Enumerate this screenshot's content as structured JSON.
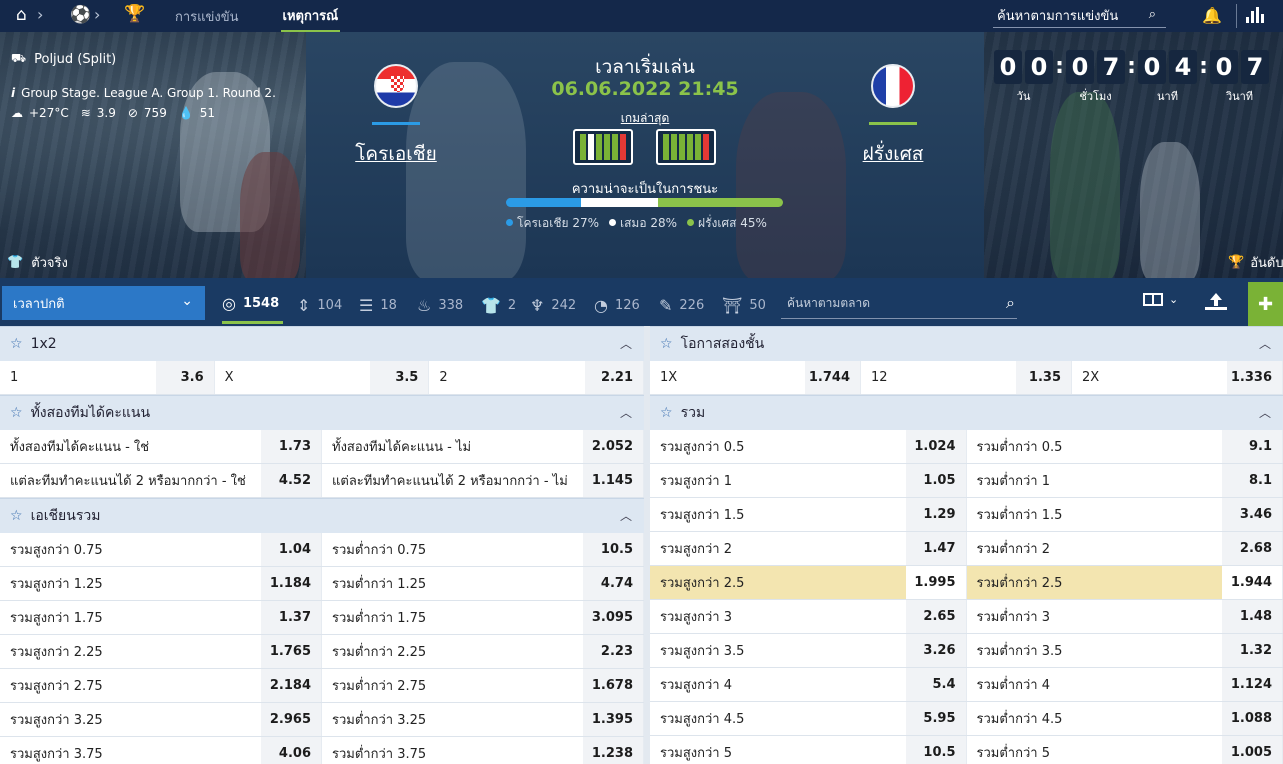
{
  "topnav": {
    "tabs": [
      {
        "label": "การแข่งขัน",
        "active": false
      },
      {
        "label": "เหตุการณ์",
        "active": true
      }
    ],
    "search_label": "ค้นหาตามการแข่งขัน"
  },
  "match": {
    "venue": "Poljud (Split)",
    "stage": "Group Stage. League A. Group 1. Round 2.",
    "weather": {
      "temp": "+27°C",
      "wind": "3.9",
      "pressure": "759",
      "humidity": "51"
    },
    "kickoff_label": "เวลาเริ่มเล่น",
    "kickoff_datetime": "06.06.2022 21:45",
    "recent_games_label": "เกมล่าสุด",
    "home": {
      "name": "โครเอเชีย",
      "bar_color": "#2b9be6"
    },
    "away": {
      "name": "ฝรั่งเศส",
      "bar_color": "#8bc34a"
    },
    "win_prob_title": "ความน่าจะเป็นในการชนะ",
    "win_prob": [
      {
        "label": "โครเอเชีย 27%",
        "value": 27,
        "color": "#2b9be6"
      },
      {
        "label": "เสมอ 28%",
        "value": 28,
        "color": "#ffffff"
      },
      {
        "label": "ฝรั่งเศส 45%",
        "value": 45,
        "color": "#8bc34a"
      }
    ],
    "home_form": [
      "win",
      "draw",
      "win",
      "win",
      "win",
      "loss"
    ],
    "away_form": [
      "win",
      "win",
      "win",
      "win",
      "win",
      "loss"
    ],
    "lineups_label": "ตัวจริง",
    "ranking_label": "อันดับ"
  },
  "countdown": [
    {
      "digits": [
        "0",
        "0"
      ],
      "label": "วัน"
    },
    {
      "digits": [
        "0",
        "7"
      ],
      "label": "ชั่วโมง"
    },
    {
      "digits": [
        "0",
        "4"
      ],
      "label": "นาที"
    },
    {
      "digits": [
        "0",
        "7"
      ],
      "label": "วินาที"
    }
  ],
  "toolbar": {
    "period": "เวลาปกติ",
    "tabs": [
      {
        "icon": "target-icon",
        "glyph": "◎",
        "count": "1548",
        "active": true
      },
      {
        "icon": "updown-icon",
        "glyph": "⇕",
        "count": "104",
        "active": false
      },
      {
        "icon": "ladder-icon",
        "glyph": "☰",
        "count": "18",
        "active": false
      },
      {
        "icon": "fire-icon",
        "glyph": "♨",
        "count": "338",
        "active": false
      },
      {
        "icon": "shirt-icon",
        "glyph": "👕",
        "count": "2",
        "active": false
      },
      {
        "icon": "trophy-cup-icon",
        "glyph": "♆",
        "count": "242",
        "active": false
      },
      {
        "icon": "timer-icon",
        "glyph": "◔",
        "count": "126",
        "active": false
      },
      {
        "icon": "magic-icon",
        "glyph": "✎",
        "count": "226",
        "active": false
      },
      {
        "icon": "gate-icon",
        "glyph": "⛩",
        "count": "50",
        "active": false
      }
    ],
    "search_placeholder": "ค้นหาตามตลาด"
  },
  "markets_left": [
    {
      "title": "1x2",
      "rows": [
        [
          {
            "label": "1",
            "odd": "3.6"
          },
          {
            "label": "X",
            "odd": "3.5"
          },
          {
            "label": "2",
            "odd": "2.21"
          }
        ]
      ]
    },
    {
      "title": "ทั้งสองทีมได้คะแนน",
      "rows": [
        [
          {
            "label": "ทั้งสองทีมได้คะแนน - ใช่",
            "odd": "1.73"
          },
          {
            "label": "ทั้งสองทีมได้คะแนน - ไม่",
            "odd": "2.052"
          }
        ],
        [
          {
            "label": "แต่ละทีมทำคะแนนได้ 2 หรือมากกว่า - ใช่",
            "odd": "4.52"
          },
          {
            "label": "แต่ละทีมทำคะแนนได้ 2 หรือมากกว่า - ไม่",
            "odd": "1.145"
          }
        ]
      ]
    },
    {
      "title": "เอเชียนรวม",
      "rows": [
        [
          {
            "label": "รวมสูงกว่า 0.75",
            "odd": "1.04"
          },
          {
            "label": "รวมต่ำกว่า 0.75",
            "odd": "10.5"
          }
        ],
        [
          {
            "label": "รวมสูงกว่า 1.25",
            "odd": "1.184"
          },
          {
            "label": "รวมต่ำกว่า 1.25",
            "odd": "4.74"
          }
        ],
        [
          {
            "label": "รวมสูงกว่า 1.75",
            "odd": "1.37"
          },
          {
            "label": "รวมต่ำกว่า 1.75",
            "odd": "3.095"
          }
        ],
        [
          {
            "label": "รวมสูงกว่า 2.25",
            "odd": "1.765"
          },
          {
            "label": "รวมต่ำกว่า 2.25",
            "odd": "2.23"
          }
        ],
        [
          {
            "label": "รวมสูงกว่า 2.75",
            "odd": "2.184"
          },
          {
            "label": "รวมต่ำกว่า 2.75",
            "odd": "1.678"
          }
        ],
        [
          {
            "label": "รวมสูงกว่า 3.25",
            "odd": "2.965"
          },
          {
            "label": "รวมต่ำกว่า 3.25",
            "odd": "1.395"
          }
        ],
        [
          {
            "label": "รวมสูงกว่า 3.75",
            "odd": "4.06"
          },
          {
            "label": "รวมต่ำกว่า 3.75",
            "odd": "1.238"
          }
        ]
      ]
    }
  ],
  "markets_right": [
    {
      "title": "โอกาสสองชั้น",
      "rows": [
        [
          {
            "label": "1X",
            "odd": "1.744"
          },
          {
            "label": "12",
            "odd": "1.35"
          },
          {
            "label": "2X",
            "odd": "1.336"
          }
        ]
      ]
    },
    {
      "title": "รวม",
      "rows": [
        [
          {
            "label": "รวมสูงกว่า 0.5",
            "odd": "1.024"
          },
          {
            "label": "รวมต่ำกว่า 0.5",
            "odd": "9.1"
          }
        ],
        [
          {
            "label": "รวมสูงกว่า 1",
            "odd": "1.05"
          },
          {
            "label": "รวมต่ำกว่า 1",
            "odd": "8.1"
          }
        ],
        [
          {
            "label": "รวมสูงกว่า 1.5",
            "odd": "1.29"
          },
          {
            "label": "รวมต่ำกว่า 1.5",
            "odd": "3.46"
          }
        ],
        [
          {
            "label": "รวมสูงกว่า 2",
            "odd": "1.47"
          },
          {
            "label": "รวมต่ำกว่า 2",
            "odd": "2.68"
          }
        ],
        [
          {
            "label": "รวมสูงกว่า 2.5",
            "odd": "1.995",
            "highlight": true
          },
          {
            "label": "รวมต่ำกว่า 2.5",
            "odd": "1.944"
          }
        ],
        [
          {
            "label": "รวมสูงกว่า 3",
            "odd": "2.65"
          },
          {
            "label": "รวมต่ำกว่า 3",
            "odd": "1.48"
          }
        ],
        [
          {
            "label": "รวมสูงกว่า 3.5",
            "odd": "3.26"
          },
          {
            "label": "รวมต่ำกว่า 3.5",
            "odd": "1.32"
          }
        ],
        [
          {
            "label": "รวมสูงกว่า 4",
            "odd": "5.4"
          },
          {
            "label": "รวมต่ำกว่า 4",
            "odd": "1.124"
          }
        ],
        [
          {
            "label": "รวมสูงกว่า 4.5",
            "odd": "5.95"
          },
          {
            "label": "รวมต่ำกว่า 4.5",
            "odd": "1.088"
          }
        ],
        [
          {
            "label": "รวมสูงกว่า 5",
            "odd": "10.5"
          },
          {
            "label": "รวมต่ำกว่า 5",
            "odd": "1.005"
          }
        ]
      ]
    }
  ],
  "colors": {
    "form_win": "#7ab236",
    "form_draw": "#ffffff",
    "form_loss": "#e53935",
    "accent": "#8bc34a",
    "highlight": "#f3e5b0"
  }
}
